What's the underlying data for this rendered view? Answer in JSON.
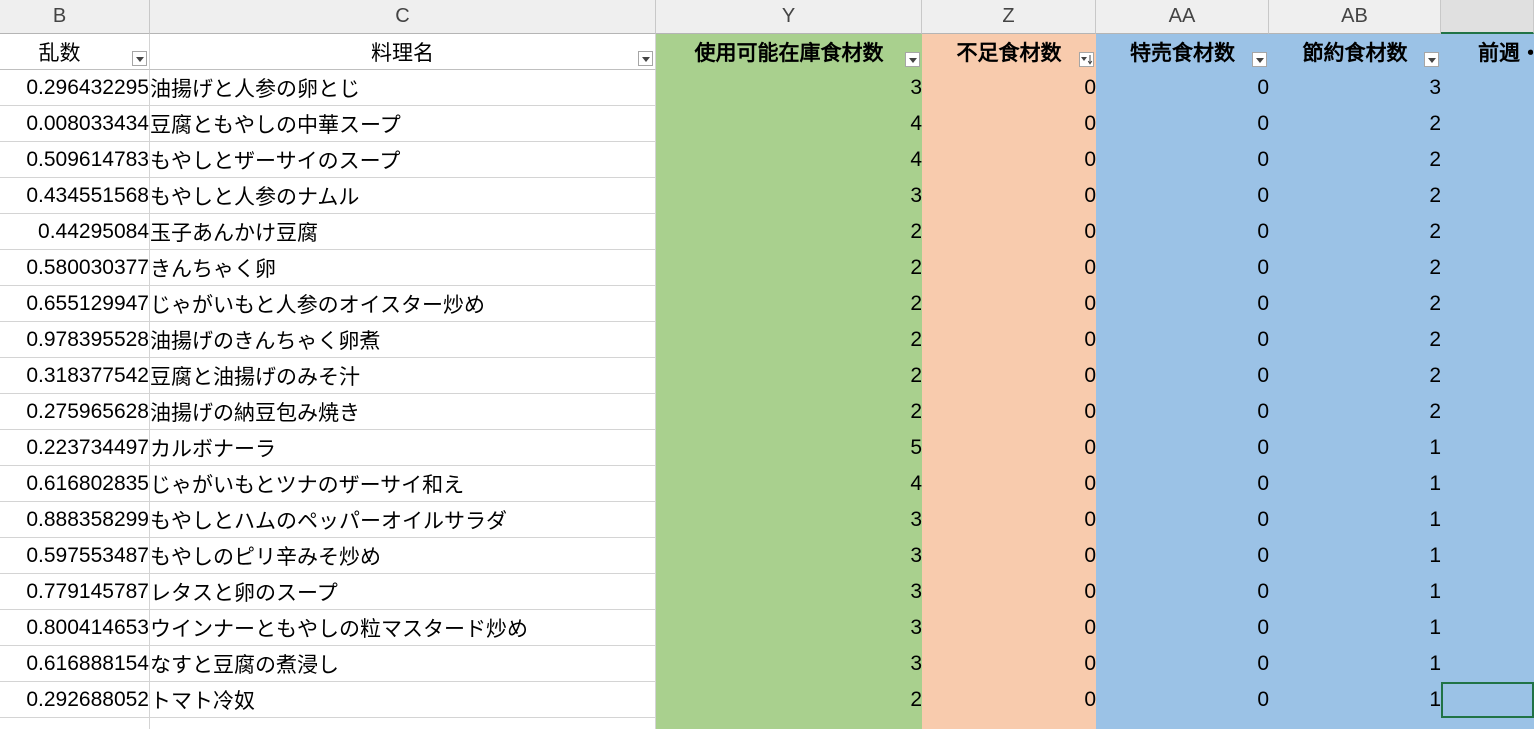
{
  "sheet": {
    "column_letters": {
      "b": "B",
      "c": "C",
      "y": "Y",
      "z": "Z",
      "aa": "AA",
      "ab": "AB"
    },
    "headers": {
      "rand": "乱数",
      "dish": "料理名",
      "usable": "使用可能在庫食材数",
      "shortage": "不足食材数",
      "sale": "特売食材数",
      "saving": "節約食材数",
      "prev": "前週・"
    },
    "rows": [
      {
        "rand": "0.296432295",
        "dish": "油揚げと人参の卵とじ",
        "usable": "3",
        "shortage": "0",
        "sale": "0",
        "saving": "3"
      },
      {
        "rand": "0.008033434",
        "dish": "豆腐ともやしの中華スープ",
        "usable": "4",
        "shortage": "0",
        "sale": "0",
        "saving": "2"
      },
      {
        "rand": "0.509614783",
        "dish": "もやしとザーサイのスープ",
        "usable": "4",
        "shortage": "0",
        "sale": "0",
        "saving": "2"
      },
      {
        "rand": "0.434551568",
        "dish": "もやしと人参のナムル",
        "usable": "3",
        "shortage": "0",
        "sale": "0",
        "saving": "2"
      },
      {
        "rand": "0.44295084",
        "dish": "玉子あんかけ豆腐",
        "usable": "2",
        "shortage": "0",
        "sale": "0",
        "saving": "2"
      },
      {
        "rand": "0.580030377",
        "dish": "きんちゃく卵",
        "usable": "2",
        "shortage": "0",
        "sale": "0",
        "saving": "2"
      },
      {
        "rand": "0.655129947",
        "dish": "じゃがいもと人参のオイスター炒め",
        "usable": "2",
        "shortage": "0",
        "sale": "0",
        "saving": "2"
      },
      {
        "rand": "0.978395528",
        "dish": "油揚げのきんちゃく卵煮",
        "usable": "2",
        "shortage": "0",
        "sale": "0",
        "saving": "2"
      },
      {
        "rand": "0.318377542",
        "dish": "豆腐と油揚げのみそ汁",
        "usable": "2",
        "shortage": "0",
        "sale": "0",
        "saving": "2"
      },
      {
        "rand": "0.275965628",
        "dish": "油揚げの納豆包み焼き",
        "usable": "2",
        "shortage": "0",
        "sale": "0",
        "saving": "2"
      },
      {
        "rand": "0.223734497",
        "dish": "カルボナーラ",
        "usable": "5",
        "shortage": "0",
        "sale": "0",
        "saving": "1"
      },
      {
        "rand": "0.616802835",
        "dish": "じゃがいもとツナのザーサイ和え",
        "usable": "4",
        "shortage": "0",
        "sale": "0",
        "saving": "1"
      },
      {
        "rand": "0.888358299",
        "dish": "もやしとハムのペッパーオイルサラダ",
        "usable": "3",
        "shortage": "0",
        "sale": "0",
        "saving": "1"
      },
      {
        "rand": "0.597553487",
        "dish": "もやしのピリ辛みそ炒め",
        "usable": "3",
        "shortage": "0",
        "sale": "0",
        "saving": "1"
      },
      {
        "rand": "0.779145787",
        "dish": "レタスと卵のスープ",
        "usable": "3",
        "shortage": "0",
        "sale": "0",
        "saving": "1"
      },
      {
        "rand": "0.800414653",
        "dish": "ウインナーともやしの粒マスタード炒め",
        "usable": "3",
        "shortage": "0",
        "sale": "0",
        "saving": "1"
      },
      {
        "rand": "0.616888154",
        "dish": "なすと豆腐の煮浸し",
        "usable": "3",
        "shortage": "0",
        "sale": "0",
        "saving": "1"
      },
      {
        "rand": "0.292688052",
        "dish": "トマト冷奴",
        "usable": "2",
        "shortage": "0",
        "sale": "0",
        "saving": "1"
      }
    ]
  },
  "colors": {
    "usable_fill": "#a9d08e",
    "shortage_fill": "#f8cbad",
    "sale_fill": "#9bc2e6",
    "selection_border": "#217346"
  },
  "icons": {
    "filter": "filter-dropdown-icon",
    "sort_filter": "sort-descending-filter-icon"
  }
}
